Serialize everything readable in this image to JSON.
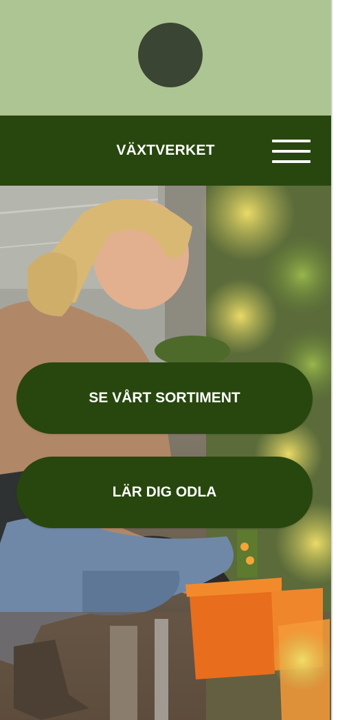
{
  "header": {
    "brand": "VÄXTVERKET",
    "logo_icon": "logo-circle",
    "menu_icon": "hamburger-menu-icon"
  },
  "hero": {
    "image": "woman-gardening-in-greenhouse-photo",
    "buttons": [
      {
        "label": "SE VÅRT SORTIMENT"
      },
      {
        "label": "LÄR DIG ODLA"
      }
    ]
  },
  "colors": {
    "top_band": "#adc593",
    "logo": "#3b4533",
    "nav": "#27470e",
    "button": "#27470e",
    "text": "#ffffff"
  }
}
